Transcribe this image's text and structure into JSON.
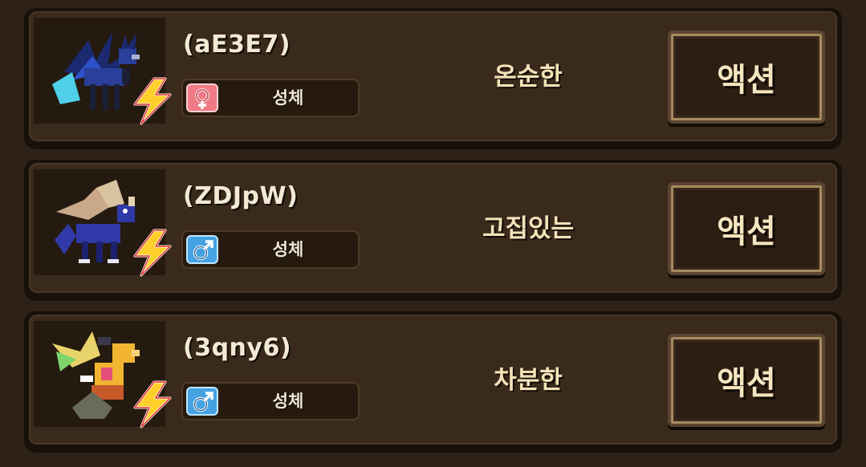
{
  "creatures": [
    {
      "name": "(aE3E7)",
      "gender": "female",
      "gender_icon": "female-icon",
      "growth_stage": "성체",
      "trait": "온순한",
      "action_label": "액션",
      "theme": {
        "body": "#2a3f9a",
        "accent": "#4fd0e8",
        "wing": "#1b2a70"
      }
    },
    {
      "name": "(ZDJpW)",
      "gender": "male",
      "gender_icon": "male-icon",
      "growth_stage": "성체",
      "trait": "고집있는",
      "action_label": "액션",
      "theme": {
        "body": "#2f3aa8",
        "accent": "#d9c3a0",
        "wing": "#c9a98a"
      }
    },
    {
      "name": "(3qny6)",
      "gender": "male",
      "gender_icon": "male-icon",
      "growth_stage": "성체",
      "trait": "차분한",
      "action_label": "액션",
      "theme": {
        "body": "#f2b531",
        "accent": "#7cd46a",
        "wing": "#e7d36a"
      }
    }
  ],
  "colors": {
    "background": "#2e2218",
    "card": "#3a2a1c",
    "female": "#f07a86",
    "male": "#45a3e3",
    "bolt": "#ffd02a"
  }
}
